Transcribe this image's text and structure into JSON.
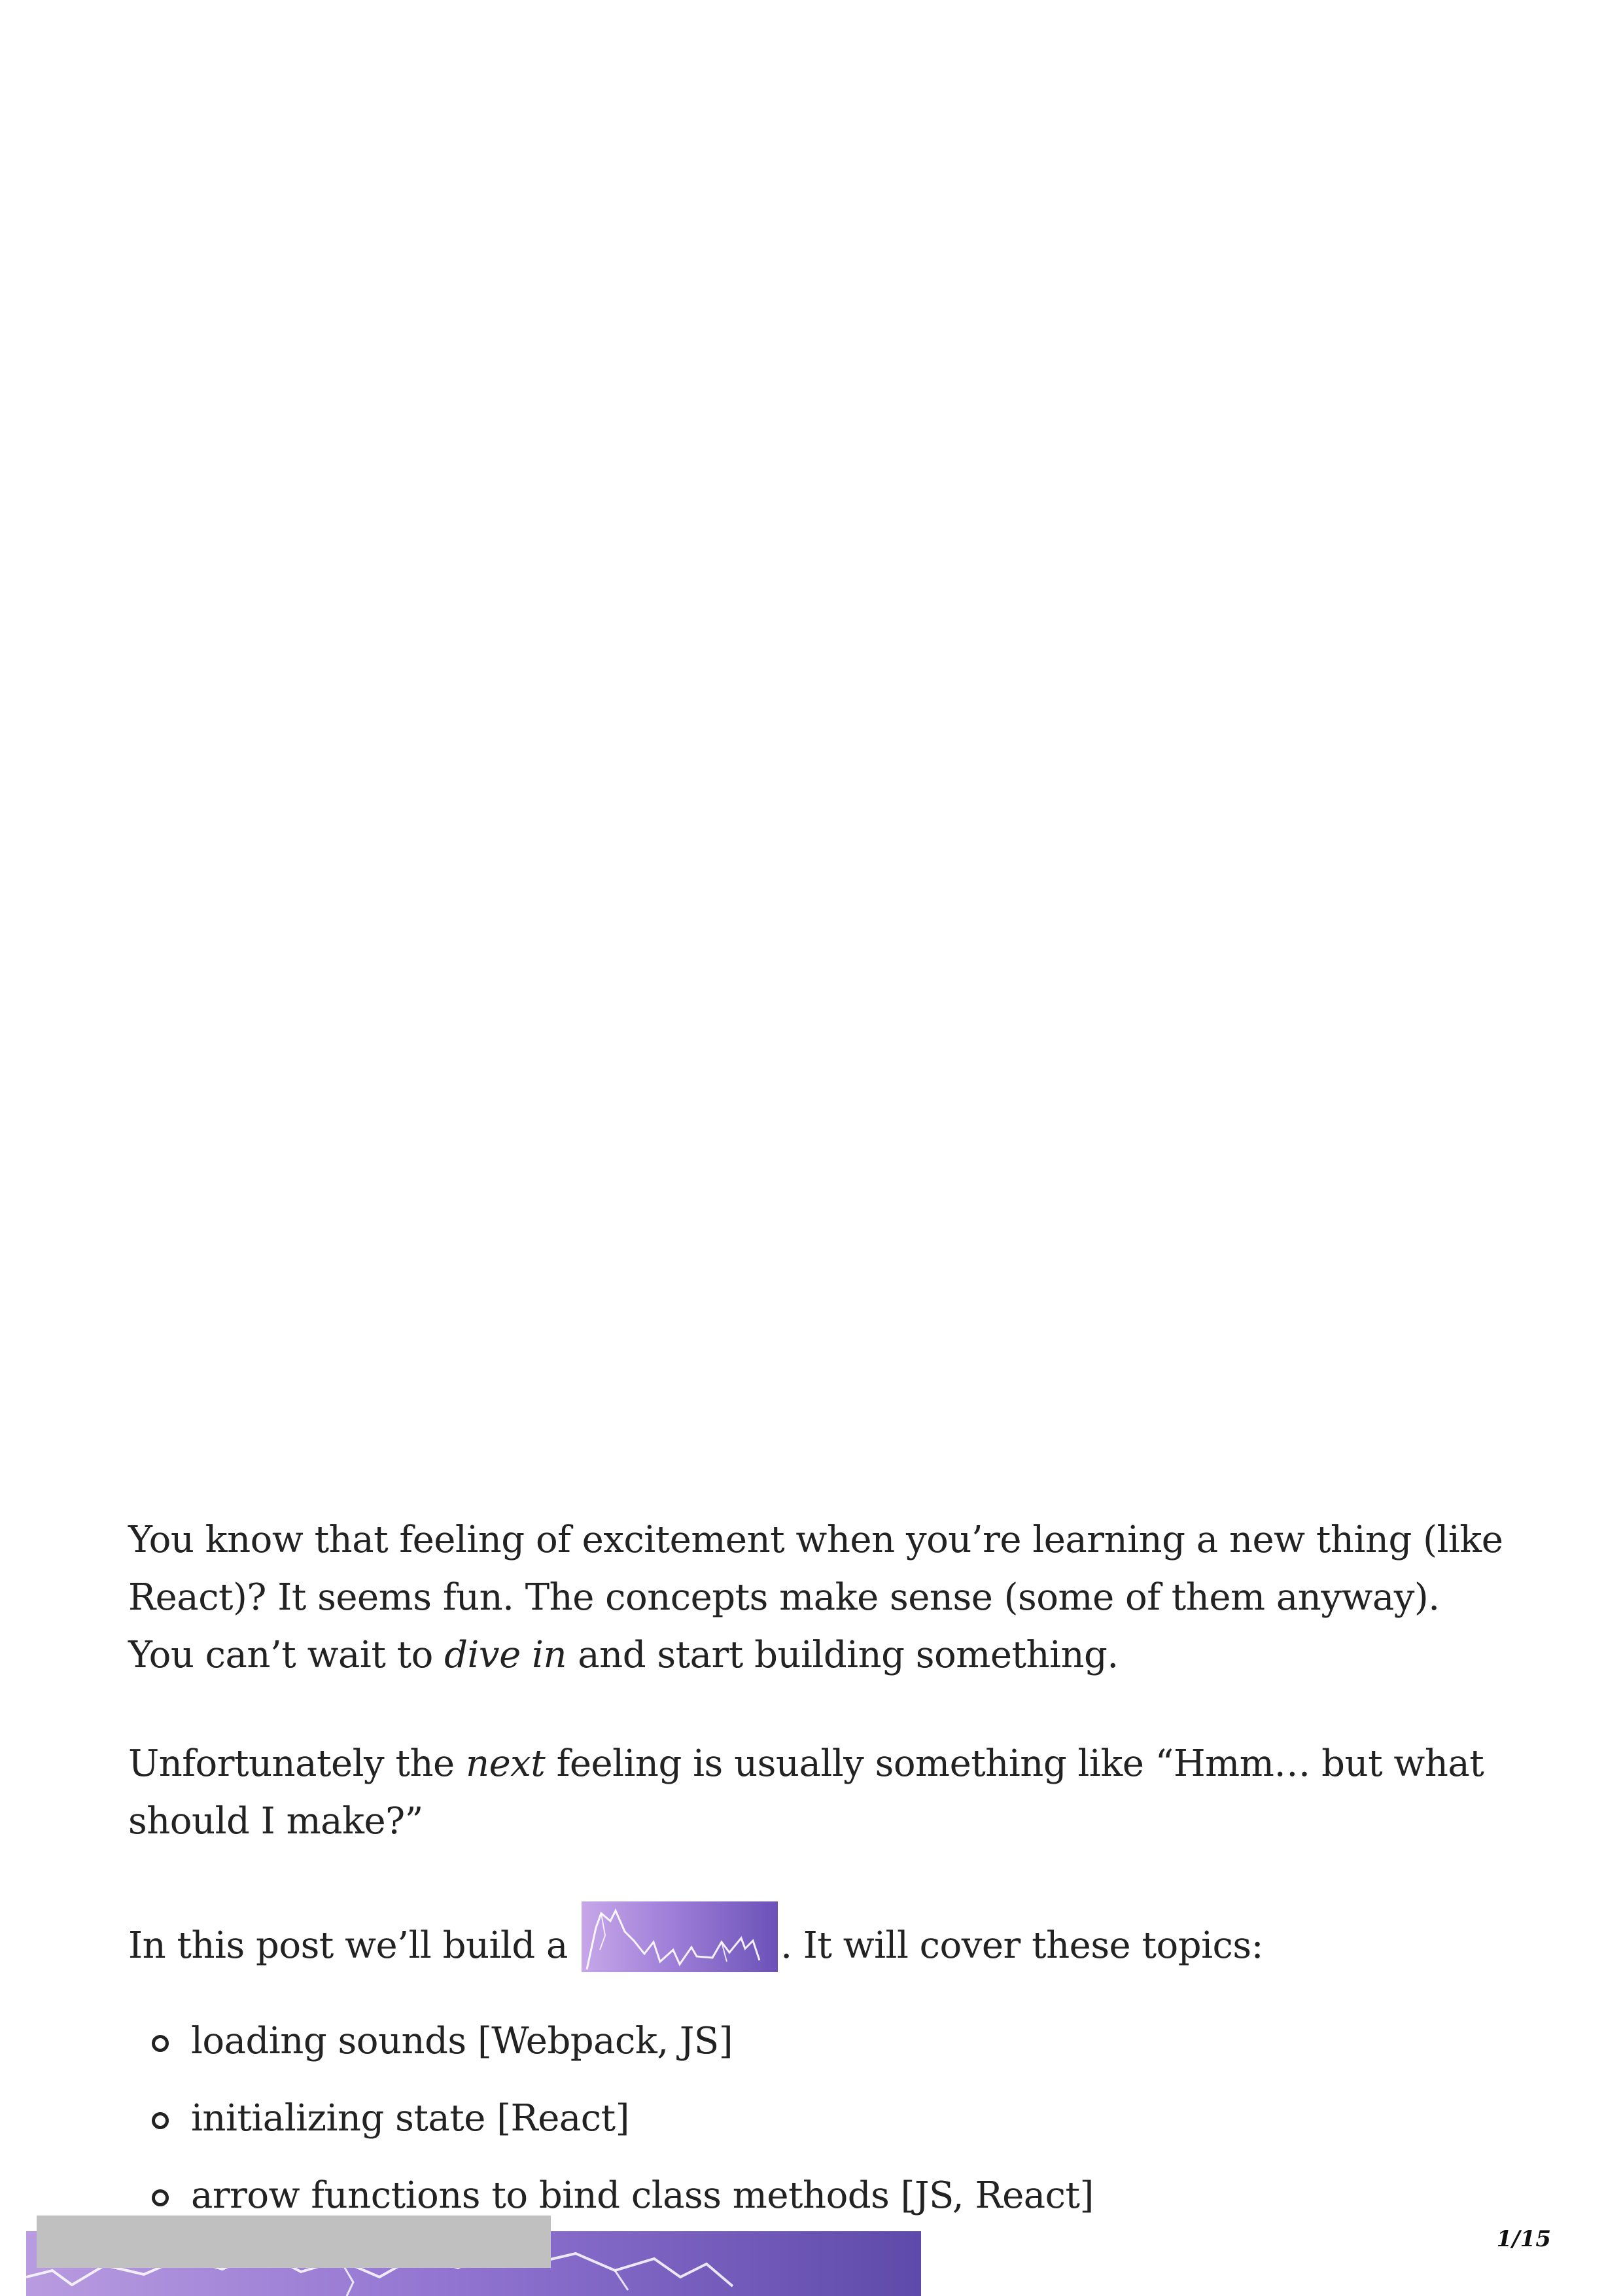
{
  "article": {
    "para1": {
      "text_a": "You know that feeling of excitement when you’re learning a new thing (like React)? It seems fun. The concepts make sense (some of them anyway). You can’t wait to ",
      "em": "dive in",
      "text_b": " and start building something."
    },
    "para2": {
      "text_a": "Unfortunately the ",
      "em": "next",
      "text_b": " feeling is usually something like “Hmm… but what should I make?”"
    },
    "para3": {
      "text_a": "In this post we’ll build a ",
      "text_b": ". It will cover these topics:"
    },
    "topics": [
      "loading sounds [Webpack, JS]",
      "initializing state [React]",
      "arrow functions to bind class methods [JS, React]"
    ]
  },
  "page_number": "1/15",
  "colors": {
    "text": "#222222",
    "lightning_light": "#c7a7e8",
    "lightning_dark": "#5e4aaa",
    "overlay_grey": "#c0c0c0"
  },
  "icons": {
    "bullet": "hollow-circle"
  }
}
